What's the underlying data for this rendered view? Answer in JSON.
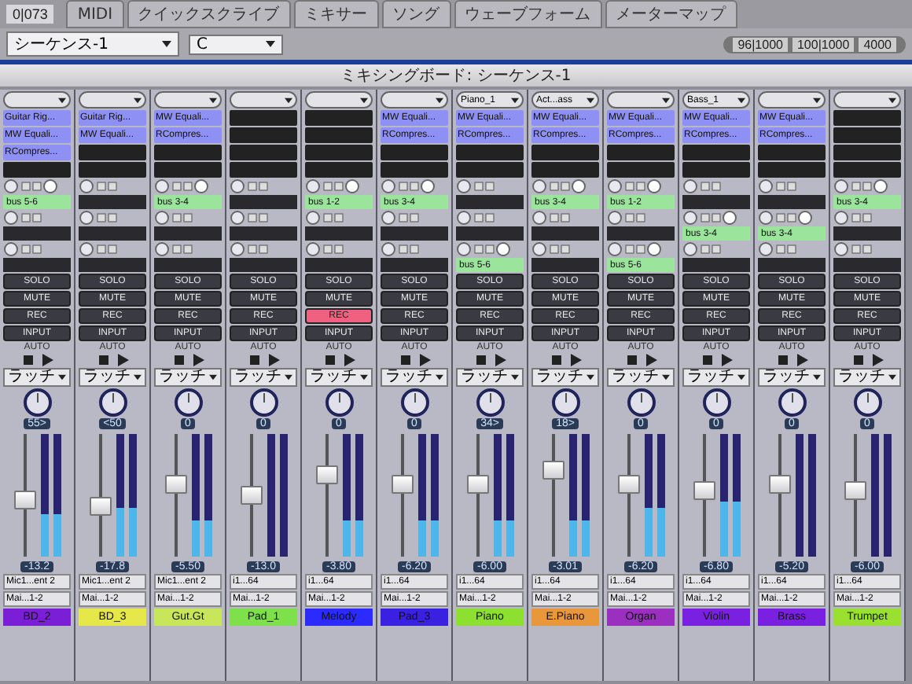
{
  "toolbar": {
    "counter": "0|073",
    "tabs": [
      "MIDI",
      "クイックスクライブ",
      "ミキサー",
      "ソング",
      "ウェーブフォーム",
      "メーターマップ"
    ],
    "sequence": "シーケンス-1",
    "key": "C",
    "zoom_fields": [
      "96|1000",
      "100|1000",
      "4000"
    ]
  },
  "window": {
    "title": "ミキシングボード: シーケンス-1"
  },
  "strips": [
    {
      "inserts": [
        "Guitar Rig...",
        "MW Equali...",
        "RCompres..."
      ],
      "sends": [
        {
          "kind": "bus",
          "label": "bus 5-6"
        },
        {
          "kind": "empty"
        },
        {
          "kind": "empty"
        }
      ],
      "buttons": [
        {
          "label": "SOLO",
          "on": false
        },
        {
          "label": "MUTE",
          "on": false
        },
        {
          "label": "REC",
          "on": false
        },
        {
          "label": "INPUT",
          "on": false
        }
      ],
      "auto": {
        "label": "AUTO",
        "mode": "ラッチ"
      },
      "pan": "55>",
      "fader": {
        "level": 0.45,
        "reading": "-13.2"
      },
      "meters": [
        {
          "level": 0.35
        },
        {
          "level": 0.35
        }
      ],
      "io": [
        "Mic1...ent 2",
        "Mai...1-2"
      ],
      "name": "BD_2",
      "color": "#7a1fd6"
    },
    {
      "inserts": [
        "Guitar Rig...",
        "MW Equali..."
      ],
      "sends": [
        {
          "kind": "empty"
        },
        {
          "kind": "empty"
        },
        {
          "kind": "empty"
        }
      ],
      "buttons": [
        {
          "label": "SOLO",
          "on": false
        },
        {
          "label": "MUTE",
          "on": false
        },
        {
          "label": "REC",
          "on": false
        },
        {
          "label": "INPUT",
          "on": false
        }
      ],
      "auto": {
        "label": "AUTO",
        "mode": "ラッチ"
      },
      "pan": "<50",
      "fader": {
        "level": 0.4,
        "reading": "-17.8"
      },
      "meters": [
        {
          "level": 0.4
        },
        {
          "level": 0.4
        }
      ],
      "io": [
        "Mic1...ent 2",
        "Mai...1-2"
      ],
      "name": "BD_3",
      "color": "#e6e84a"
    },
    {
      "inserts": [
        "MW Equali...",
        "RCompres..."
      ],
      "sends": [
        {
          "kind": "bus",
          "label": "bus 3-4"
        },
        {
          "kind": "empty"
        },
        {
          "kind": "empty"
        }
      ],
      "buttons": [
        {
          "label": "SOLO",
          "on": false
        },
        {
          "label": "MUTE",
          "on": false
        },
        {
          "label": "REC",
          "on": false
        },
        {
          "label": "INPUT",
          "on": false
        }
      ],
      "auto": {
        "label": "AUTO",
        "mode": "ラッチ"
      },
      "pan": "0",
      "fader": {
        "level": 0.6,
        "reading": "-5.50"
      },
      "meters": [
        {
          "level": 0.3
        },
        {
          "level": 0.3
        }
      ],
      "io": [
        "Mic1...ent 2",
        "Mai...1-2"
      ],
      "name": "Gut.Gt",
      "color": "#c8e65a"
    },
    {
      "sends": [
        {
          "kind": "empty"
        },
        {
          "kind": "empty"
        },
        {
          "kind": "empty"
        }
      ],
      "buttons": [
        {
          "label": "SOLO",
          "on": false
        },
        {
          "label": "MUTE",
          "on": false
        },
        {
          "label": "REC",
          "on": false
        },
        {
          "label": "INPUT",
          "on": false
        }
      ],
      "auto": {
        "label": "AUTO",
        "mode": "ラッチ"
      },
      "pan": "0",
      "fader": {
        "level": 0.5,
        "reading": "-13.0"
      },
      "io": [
        "i1...64",
        "Mai...1-2"
      ],
      "name": "Pad_1",
      "color": "#7ee04a"
    },
    {
      "sends": [
        {
          "kind": "bus",
          "label": "bus 1-2"
        },
        {
          "kind": "empty"
        },
        {
          "kind": "empty"
        }
      ],
      "buttons": [
        {
          "label": "SOLO",
          "on": false
        },
        {
          "label": "MUTE",
          "on": false
        },
        {
          "label": "REC",
          "on": true
        },
        {
          "label": "INPUT",
          "on": false
        }
      ],
      "auto": {
        "label": "AUTO",
        "mode": "ラッチ"
      },
      "pan": "0",
      "fader": {
        "level": 0.7,
        "reading": "-3.80"
      },
      "meters": [
        {
          "level": 0.3
        },
        {
          "level": 0.3
        }
      ],
      "io": [
        "i1...64",
        "Mai...1-2"
      ],
      "name": "Melody",
      "color": "#2b2bff"
    },
    {
      "inserts": [
        "MW Equali...",
        "RCompres..."
      ],
      "sends": [
        {
          "kind": "bus",
          "label": "bus 3-4"
        },
        {
          "kind": "empty"
        },
        {
          "kind": "empty"
        }
      ],
      "buttons": [
        {
          "label": "SOLO",
          "on": false
        },
        {
          "label": "MUTE",
          "on": false
        },
        {
          "label": "REC",
          "on": false
        },
        {
          "label": "INPUT",
          "on": false
        }
      ],
      "auto": {
        "label": "AUTO",
        "mode": "ラッチ"
      },
      "pan": "0",
      "fader": {
        "level": 0.6,
        "reading": "-6.20"
      },
      "meters": [
        {
          "level": 0.3
        },
        {
          "level": 0.3
        }
      ],
      "io": [
        "i1...64",
        "Mai...1-2"
      ],
      "name": "Pad_3",
      "color": "#3a20e0"
    },
    {
      "group": "Piano_1",
      "inserts": [
        "MW Equali...",
        "RCompres..."
      ],
      "sends": [
        {
          "kind": "empty"
        },
        {
          "kind": "empty"
        },
        {
          "kind": "bus",
          "label": "bus 5-6"
        }
      ],
      "buttons": [
        {
          "label": "SOLO",
          "on": false
        },
        {
          "label": "MUTE",
          "on": false
        },
        {
          "label": "REC",
          "on": false
        },
        {
          "label": "INPUT",
          "on": false
        }
      ],
      "auto": {
        "label": "AUTO",
        "mode": "ラッチ"
      },
      "pan": "34>",
      "fader": {
        "level": 0.6,
        "reading": "-6.00"
      },
      "meters": [
        {
          "level": 0.3
        },
        {
          "level": 0.3
        }
      ],
      "io": [
        "i1...64",
        "Mai...1-2"
      ],
      "name": "Piano",
      "color": "#8ee030"
    },
    {
      "group": "Act...ass",
      "inserts": [
        "MW Equali...",
        "RCompres..."
      ],
      "sends": [
        {
          "kind": "bus",
          "label": "bus 3-4"
        },
        {
          "kind": "empty"
        },
        {
          "kind": "empty"
        }
      ],
      "buttons": [
        {
          "label": "SOLO",
          "on": false
        },
        {
          "label": "MUTE",
          "on": false
        },
        {
          "label": "REC",
          "on": false
        },
        {
          "label": "INPUT",
          "on": false
        }
      ],
      "auto": {
        "label": "AUTO",
        "mode": "ラッチ"
      },
      "pan": "18>",
      "fader": {
        "level": 0.75,
        "reading": "-3.01"
      },
      "meters": [
        {
          "level": 0.3
        },
        {
          "level": 0.3
        }
      ],
      "io": [
        "i1...64",
        "Mai...1-2"
      ],
      "name": "E.Piano",
      "color": "#e8983a"
    },
    {
      "inserts": [
        "MW Equali...",
        "RCompres..."
      ],
      "sends": [
        {
          "kind": "bus",
          "label": "bus 1-2"
        },
        {
          "kind": "empty"
        },
        {
          "kind": "bus",
          "label": "bus 5-6"
        }
      ],
      "buttons": [
        {
          "label": "SOLO",
          "on": false
        },
        {
          "label": "MUTE",
          "on": false
        },
        {
          "label": "REC",
          "on": false
        },
        {
          "label": "INPUT",
          "on": false
        }
      ],
      "auto": {
        "label": "AUTO",
        "mode": "ラッチ"
      },
      "pan": "0",
      "fader": {
        "level": 0.6,
        "reading": "-6.20"
      },
      "meters": [
        {
          "level": 0.4
        },
        {
          "level": 0.4
        }
      ],
      "io": [
        "i1...64",
        "Mai...1-2"
      ],
      "name": "Organ",
      "color": "#9a2fc0"
    },
    {
      "group": "Bass_1",
      "inserts": [
        "MW Equali...",
        "RCompres..."
      ],
      "sends": [
        {
          "kind": "empty"
        },
        {
          "kind": "bus",
          "label": "bus 3-4"
        },
        {
          "kind": "empty"
        }
      ],
      "buttons": [
        {
          "label": "SOLO",
          "on": false
        },
        {
          "label": "MUTE",
          "on": false
        },
        {
          "label": "REC",
          "on": false
        },
        {
          "label": "INPUT",
          "on": false
        }
      ],
      "auto": {
        "label": "AUTO",
        "mode": "ラッチ"
      },
      "pan": "0",
      "fader": {
        "level": 0.55,
        "reading": "-6.80"
      },
      "meters": [
        {
          "level": 0.45
        },
        {
          "level": 0.45
        }
      ],
      "io": [
        "i1...64",
        "Mai...1-2"
      ],
      "name": "Violin",
      "color": "#7a20e0"
    },
    {
      "inserts": [
        "MW Equali...",
        "RCompres..."
      ],
      "sends": [
        {
          "kind": "empty"
        },
        {
          "kind": "bus",
          "label": "bus 3-4"
        },
        {
          "kind": "empty"
        }
      ],
      "buttons": [
        {
          "label": "SOLO",
          "on": false
        },
        {
          "label": "MUTE",
          "on": false
        },
        {
          "label": "REC",
          "on": false
        },
        {
          "label": "INPUT",
          "on": false
        }
      ],
      "auto": {
        "label": "AUTO",
        "mode": "ラッチ"
      },
      "pan": "0",
      "fader": {
        "level": 0.6,
        "reading": "-5.20"
      },
      "io": [
        "i1...64",
        "Mai...1-2"
      ],
      "name": "Brass",
      "color": "#7a20e0"
    },
    {
      "sends": [
        {
          "kind": "bus",
          "label": "bus 3-4"
        },
        {
          "kind": "empty"
        },
        {
          "kind": "empty"
        }
      ],
      "buttons": [
        {
          "label": "SOLO",
          "on": false
        },
        {
          "label": "MUTE",
          "on": false
        },
        {
          "label": "REC",
          "on": false
        },
        {
          "label": "INPUT",
          "on": false
        }
      ],
      "auto": {
        "label": "AUTO",
        "mode": "ラッチ"
      },
      "pan": "0",
      "fader": {
        "level": 0.55,
        "reading": "-6.00"
      },
      "io": [
        "i1...64",
        "Mai...1-2"
      ],
      "name": "Trumpet",
      "color": "#9ae030"
    }
  ]
}
